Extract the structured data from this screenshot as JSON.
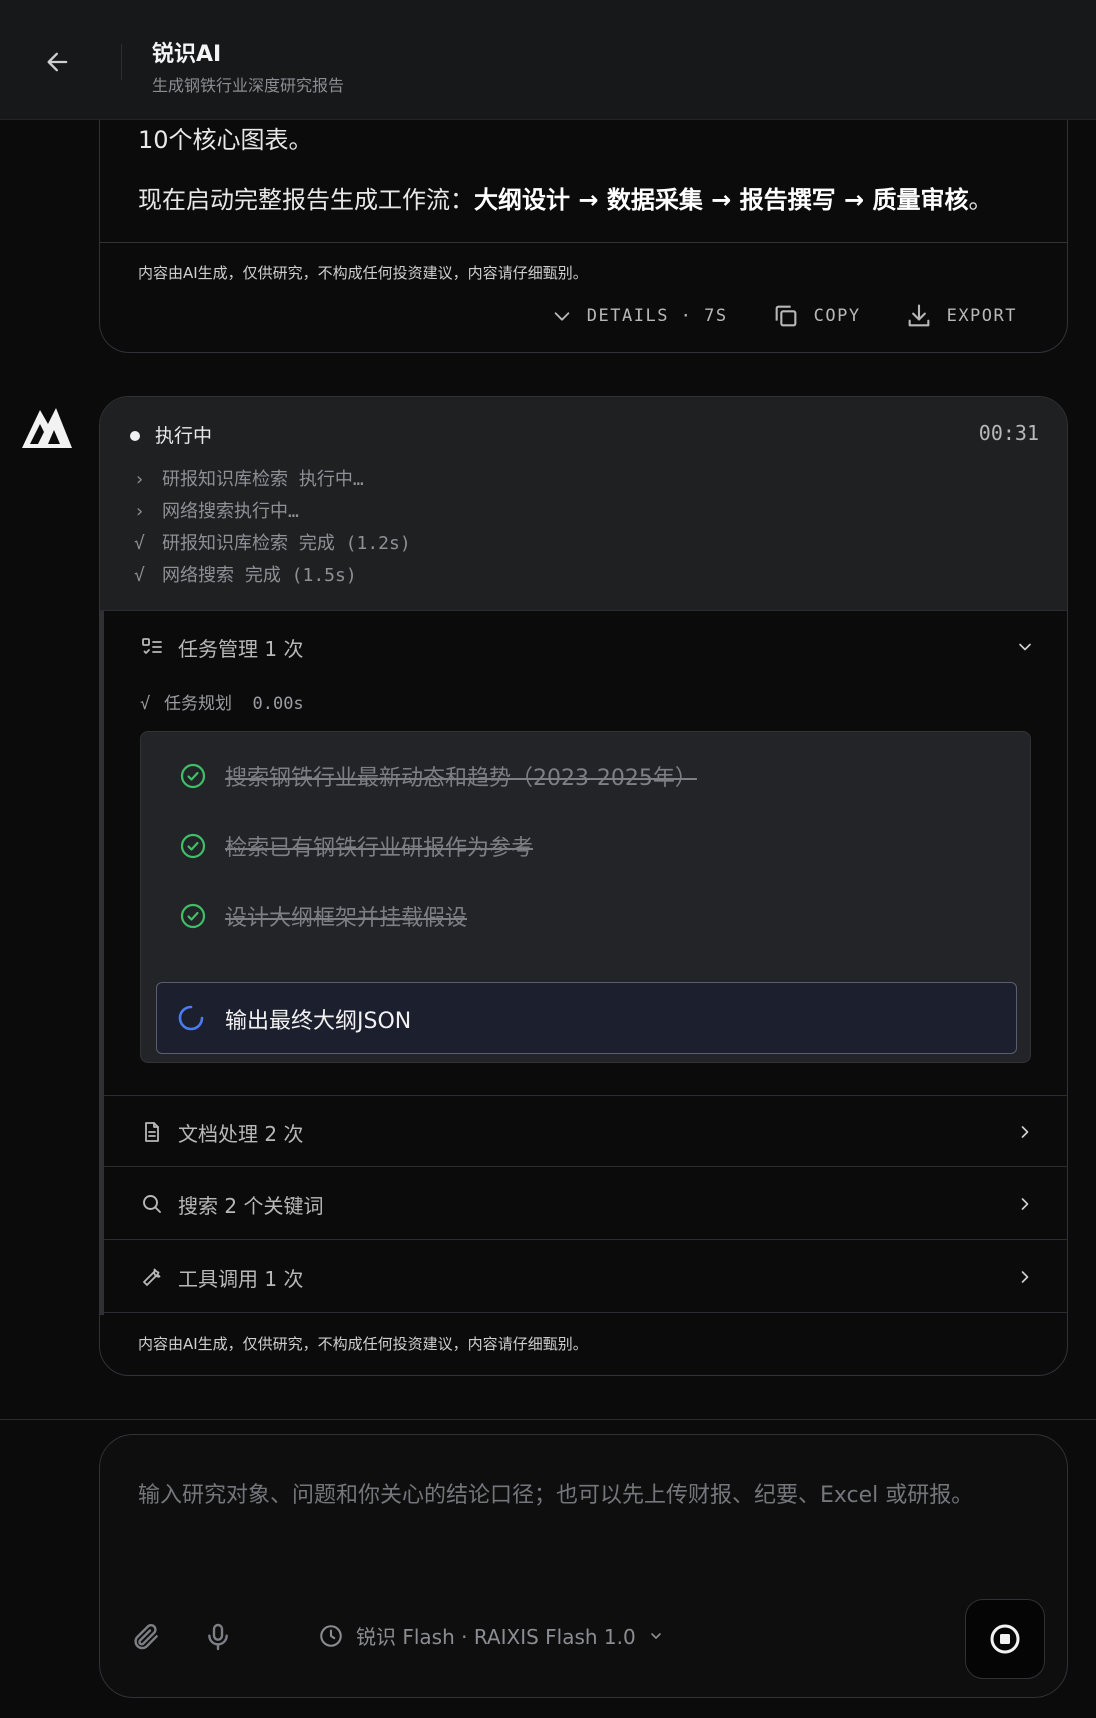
{
  "header": {
    "title": "锐识AI",
    "subtitle": "生成钢铁行业深度研究报告"
  },
  "prev_message": {
    "line1": "10个核心图表。",
    "line2_prefix": "现在启动完整报告生成工作流：",
    "line2_bold": "大纲设计 → 数据采集 → 报告撰写 → 质量审核",
    "line2_suffix": "。",
    "disclaimer": "内容由AI生成，仅供研究，不构成任何投资建议，内容请仔细甄别。",
    "actions": {
      "details": "DETAILS · 7S",
      "copy": "COPY",
      "export": "EXPORT"
    }
  },
  "execution": {
    "status": "执行中",
    "timer": "00:31",
    "logs": [
      {
        "mark": "›",
        "text": "研报知识库检索 执行中…"
      },
      {
        "mark": "›",
        "text": "网络搜索执行中…"
      },
      {
        "mark": "√",
        "text": "研报知识库检索 完成 (1.2s)"
      },
      {
        "mark": "√",
        "text": "网络搜索 完成 (1.5s)"
      }
    ],
    "task_section": {
      "label": "任务管理 1 次",
      "plan_mark": "√",
      "plan_label": "任务规划",
      "plan_time": "0.00s",
      "tasks": [
        {
          "label": "搜索钢铁行业最新动态和趋势（2023-2025年）",
          "done": true
        },
        {
          "label": "检索已有钢铁行业研报作为参考",
          "done": true
        },
        {
          "label": "设计大纲框架并挂载假设",
          "done": true
        }
      ],
      "active_task": "输出最终大纲JSON"
    },
    "sections": [
      {
        "label": "文档处理 2 次"
      },
      {
        "label": "搜索 2 个关键词"
      },
      {
        "label": "工具调用 1 次"
      }
    ],
    "disclaimer": "内容由AI生成，仅供研究，不构成任何投资建议，内容请仔细甄别。"
  },
  "composer": {
    "placeholder": "输入研究对象、问题和你关心的结论口径；也可以先上传财报、纪要、Excel 或研报。",
    "model_label": "锐识 Flash · RAIXIS Flash 1.0"
  },
  "colors": {
    "accent_blue": "#4a7cf0",
    "success_green": "#3fbf68"
  }
}
